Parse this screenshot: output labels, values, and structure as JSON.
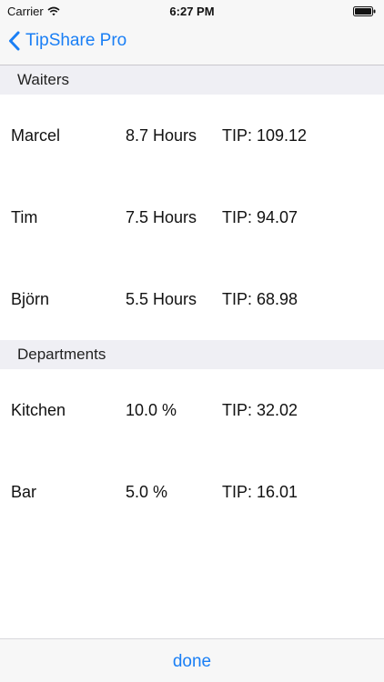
{
  "status_bar": {
    "carrier": "Carrier",
    "wifi_icon": "wifi-icon",
    "time": "6:27 PM",
    "battery_icon": "battery-icon"
  },
  "nav": {
    "back_icon": "chevron-left-icon",
    "back_label": "TipShare Pro"
  },
  "sections": [
    {
      "title": "Waiters",
      "rows": [
        {
          "name": "Marcel",
          "amount": "8.7 Hours",
          "tip": "TIP: 109.12"
        },
        {
          "name": "Tim",
          "amount": "7.5 Hours",
          "tip": "TIP: 94.07"
        },
        {
          "name": "Björn",
          "amount": "5.5 Hours",
          "tip": "TIP: 68.98"
        }
      ]
    },
    {
      "title": "Departments",
      "rows": [
        {
          "name": "Kitchen",
          "amount": "10.0 %",
          "tip": "TIP: 32.02"
        },
        {
          "name": "Bar",
          "amount": "5.0 %",
          "tip": "TIP: 16.01"
        }
      ]
    }
  ],
  "toolbar": {
    "done_label": "done"
  },
  "colors": {
    "accent": "#1a7ff5",
    "section_background": "#efeff4",
    "bar_background": "#f7f7f7"
  }
}
